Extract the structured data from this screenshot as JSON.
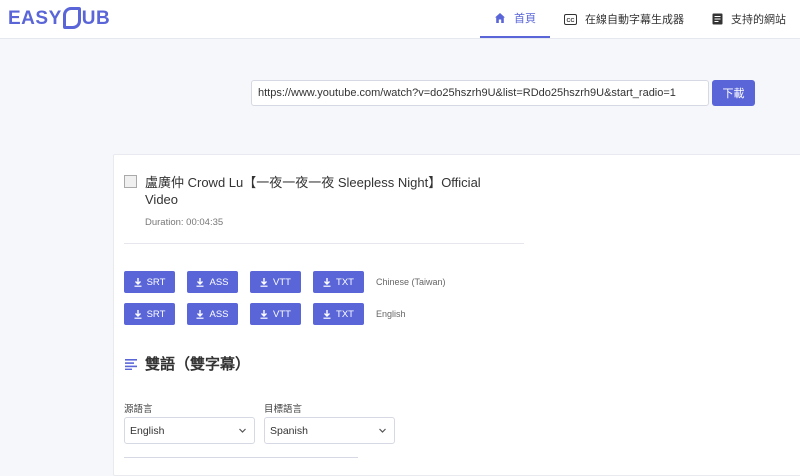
{
  "header": {
    "logo_left": "EASY",
    "logo_right": "UB",
    "nav": [
      {
        "label": "首頁",
        "icon": "home-icon",
        "active": true
      },
      {
        "label": "在線自動字幕生成器",
        "icon": "cc-icon",
        "active": false
      },
      {
        "label": "支持的網站",
        "icon": "list-doc-icon",
        "active": false
      }
    ]
  },
  "url_bar": {
    "value": "https://www.youtube.com/watch?v=do25hszrh9U&list=RDdo25hszrh9U&start_radio=1",
    "button_label": "下載"
  },
  "video": {
    "title": "盧廣仲 Crowd Lu【一夜一夜一夜 Sleepless Night】Official Video",
    "duration": "Duration: 00:04:35"
  },
  "subtitle_rows": [
    {
      "formats": [
        "SRT",
        "ASS",
        "VTT",
        "TXT"
      ],
      "language": "Chinese (Taiwan)"
    },
    {
      "formats": [
        "SRT",
        "ASS",
        "VTT",
        "TXT"
      ],
      "language": "English"
    }
  ],
  "bilingual": {
    "heading": "雙語（雙字幕）",
    "source_label": "源語言",
    "source_value": "English",
    "target_label": "目標語言",
    "target_value": "Spanish"
  },
  "colors": {
    "accent": "#5a66d8",
    "background": "#f6f7fb"
  }
}
